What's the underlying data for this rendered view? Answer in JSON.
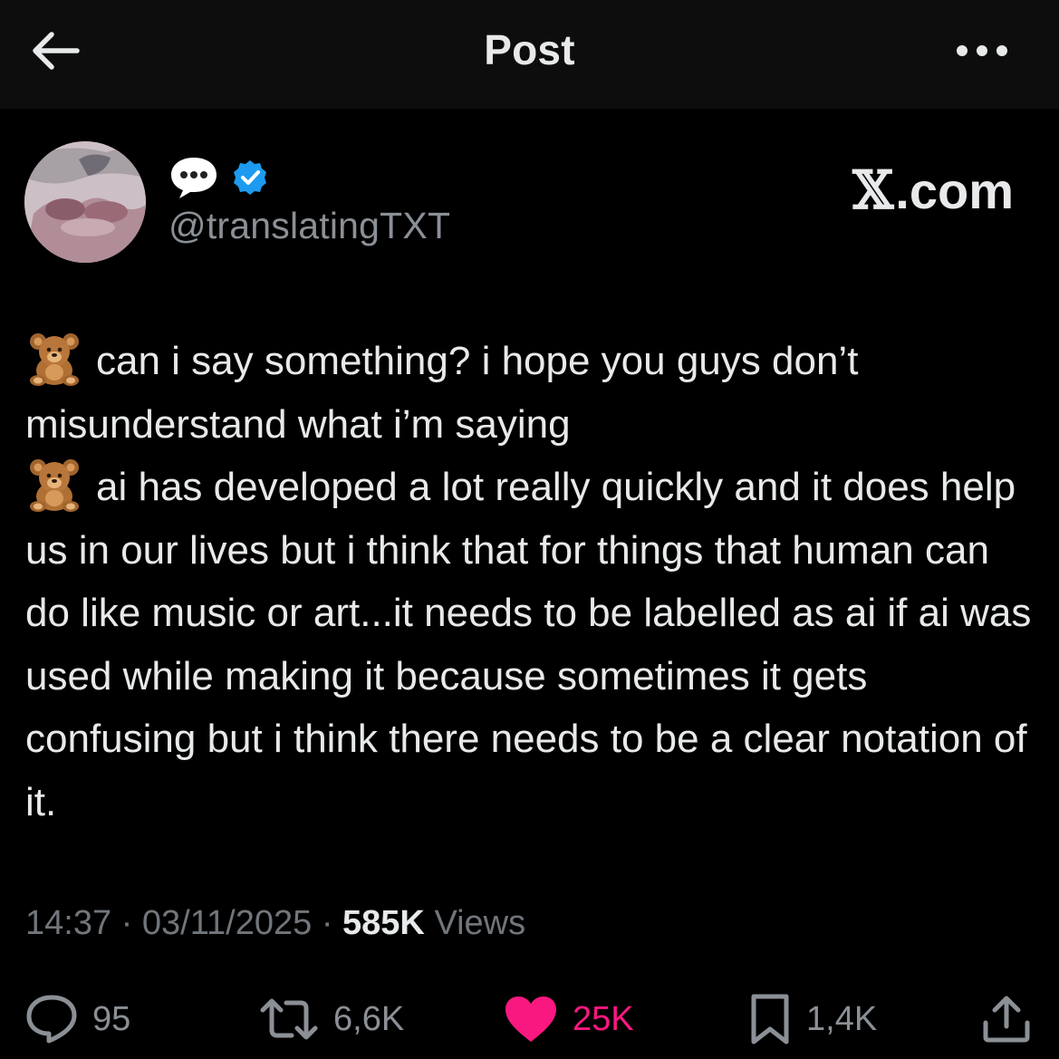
{
  "header": {
    "title": "Post",
    "back_icon": "arrow-left-icon",
    "more_icon": "more-horizontal-icon"
  },
  "author": {
    "display_name_emoji": "speech-bubble-emoji",
    "verified": true,
    "handle": "@translatingTXT"
  },
  "watermark": {
    "x_glyph": "𝕏",
    "domain": ".com"
  },
  "post": {
    "lines": [
      {
        "emoji": "teddy-bear-emoji",
        "text": "can i say something? i hope you guys don’t misunderstand what i’m saying"
      },
      {
        "emoji": "teddy-bear-emoji",
        "text": "ai has developed a lot really quickly and it does help us in our lives but i think that for things that human can do like music or art...it needs to be labelled as ai if ai was used while making it because sometimes it gets confusing but i think there needs to be a clear notation of it."
      }
    ]
  },
  "meta": {
    "time": "14:37",
    "separator": "·",
    "date": "03/11/2025",
    "views_count": "585K",
    "views_label": "Views"
  },
  "actions": {
    "replies": "95",
    "reposts": "6,6K",
    "likes": "25K",
    "bookmarks": "1,4K"
  },
  "colors": {
    "background": "#000000",
    "header_bg": "#0d0d0d",
    "text": "#e7e9ea",
    "muted": "#71767b",
    "like_pink": "#f91880",
    "verified_blue": "#1d9bf0"
  }
}
